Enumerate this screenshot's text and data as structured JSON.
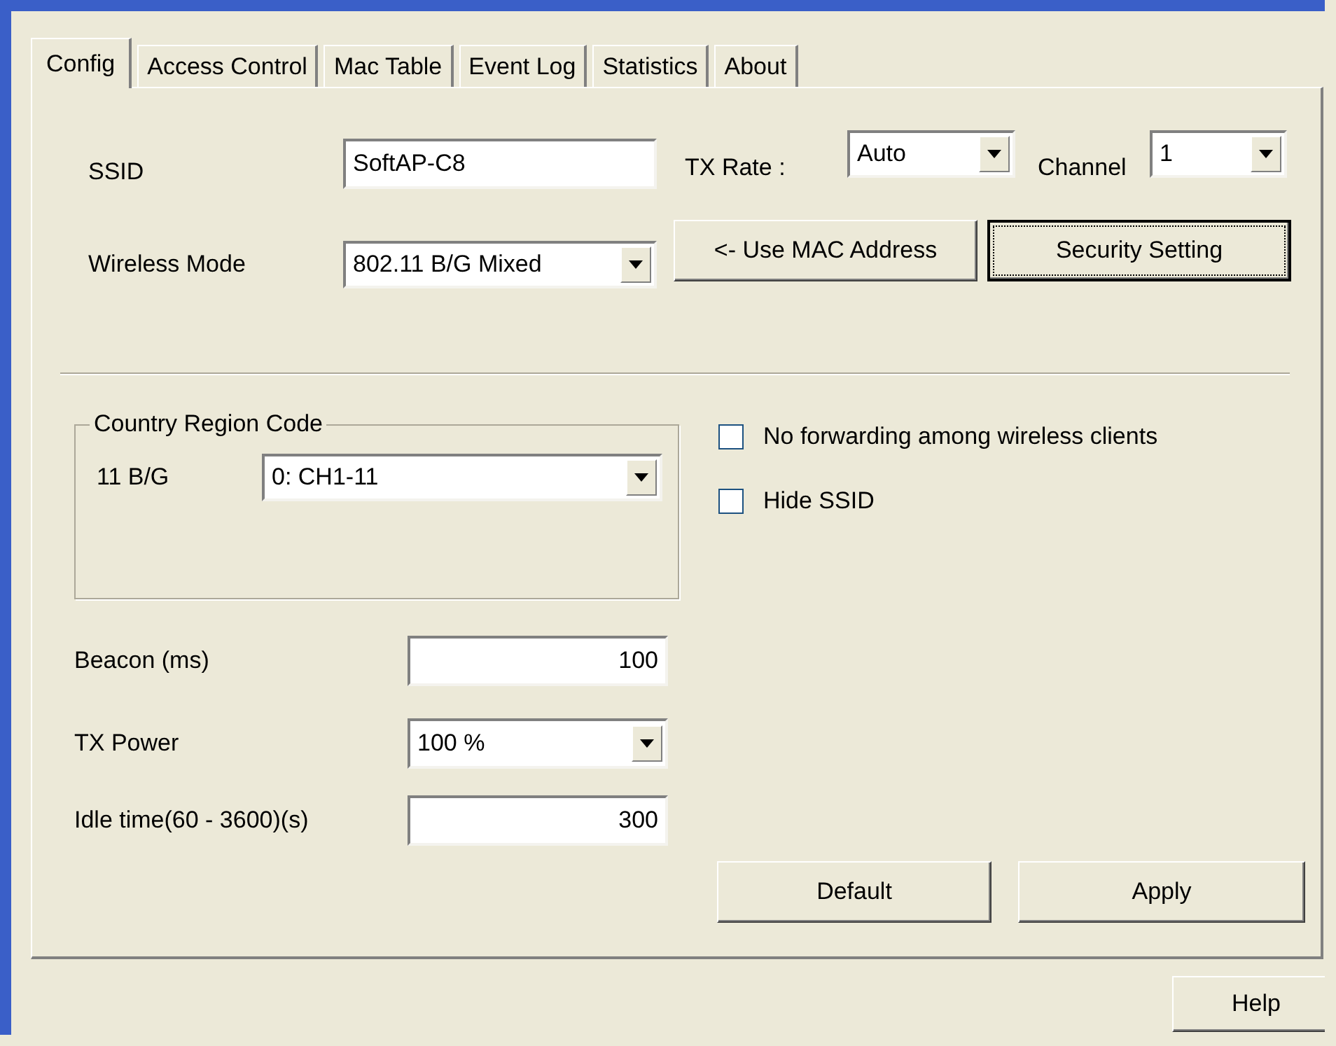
{
  "tabs": [
    {
      "label": "Config",
      "selected": true
    },
    {
      "label": "Access Control",
      "selected": false
    },
    {
      "label": "Mac Table",
      "selected": false
    },
    {
      "label": "Event Log",
      "selected": false
    },
    {
      "label": "Statistics",
      "selected": false
    },
    {
      "label": "About",
      "selected": false
    }
  ],
  "ssid": {
    "label": "SSID",
    "value": "SoftAP-C8"
  },
  "tx_rate": {
    "label": "TX Rate :",
    "value": "Auto"
  },
  "channel": {
    "label": "Channel",
    "value": "1"
  },
  "wireless_mode": {
    "label": "Wireless Mode",
    "value": "802.11 B/G Mixed"
  },
  "use_mac_button": "<- Use MAC Address",
  "security_button": {
    "label": "Security Setting",
    "focused": true
  },
  "country_region": {
    "title": "Country Region Code",
    "label": "11 B/G",
    "value": "0: CH1-11"
  },
  "options": [
    {
      "label": "No forwarding among wireless clients",
      "checked": false
    },
    {
      "label": "Hide SSID",
      "checked": false
    }
  ],
  "beacon": {
    "label": "Beacon (ms)",
    "value": "100"
  },
  "tx_power": {
    "label": "TX Power",
    "value": "100 %"
  },
  "idle_time": {
    "label": "Idle time(60 - 3600)(s)",
    "value": "300"
  },
  "buttons": [
    "Default",
    "Apply"
  ],
  "help_button": "Help"
}
